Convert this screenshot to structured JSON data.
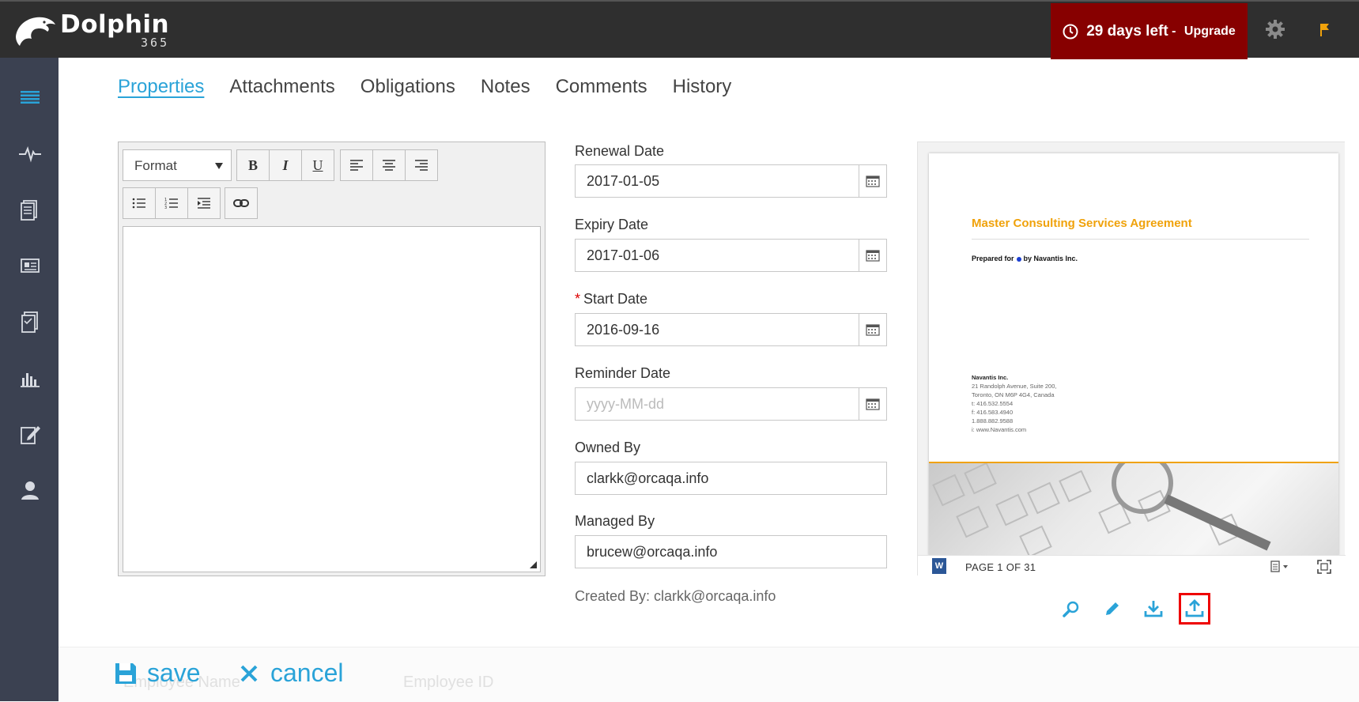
{
  "app": {
    "name": "Dolphin",
    "sub": "365"
  },
  "trial": {
    "days_left": "29 days left",
    "separator": " - ",
    "upgrade": "Upgrade"
  },
  "tabs": [
    "Properties",
    "Attachments",
    "Obligations",
    "Notes",
    "Comments",
    "History"
  ],
  "active_tab": "Properties",
  "editor": {
    "format_label": "Format",
    "bold": "B",
    "italic": "I",
    "underline": "U"
  },
  "fields": {
    "renewal": {
      "label": "Renewal Date",
      "value": "2017-01-05"
    },
    "expiry": {
      "label": "Expiry Date",
      "value": "2017-01-06"
    },
    "start": {
      "label": "Start Date",
      "required_mark": "*",
      "value": "2016-09-16"
    },
    "reminder": {
      "label": "Reminder Date",
      "placeholder": "yyyy-MM-dd"
    },
    "owned": {
      "label": "Owned By",
      "value": "clarkk@orcaqa.info"
    },
    "managed": {
      "label": "Managed By",
      "value": "brucew@orcaqa.info"
    }
  },
  "created_by": "Created By: clarkk@orcaqa.info",
  "preview": {
    "doc_title": "Master Consulting Services Agreement",
    "prepared_for": "Prepared for",
    "prepared_by": "by Navantis Inc.",
    "address": [
      "Navantis Inc.",
      "21 Randolph Avenue, Suite 200,",
      "Toronto, ON M6P 4G4, Canada",
      "t: 416.532.5554",
      "f: 416.583.4940",
      "1.888.882.9588",
      "i: www.Navantis.com"
    ],
    "page_indicator": "PAGE 1 OF 31",
    "word_badge": "W"
  },
  "bottom": {
    "save": "save",
    "cancel": "cancel",
    "ghost_name": "Employee Name",
    "ghost_id": "Employee ID"
  },
  "colors": {
    "accent": "#2aa3d8",
    "trial_bg": "#870000",
    "sidebar_bg": "#3b4151",
    "topbar_bg": "#2f2f2f",
    "doc_orange": "#f0a20b"
  }
}
